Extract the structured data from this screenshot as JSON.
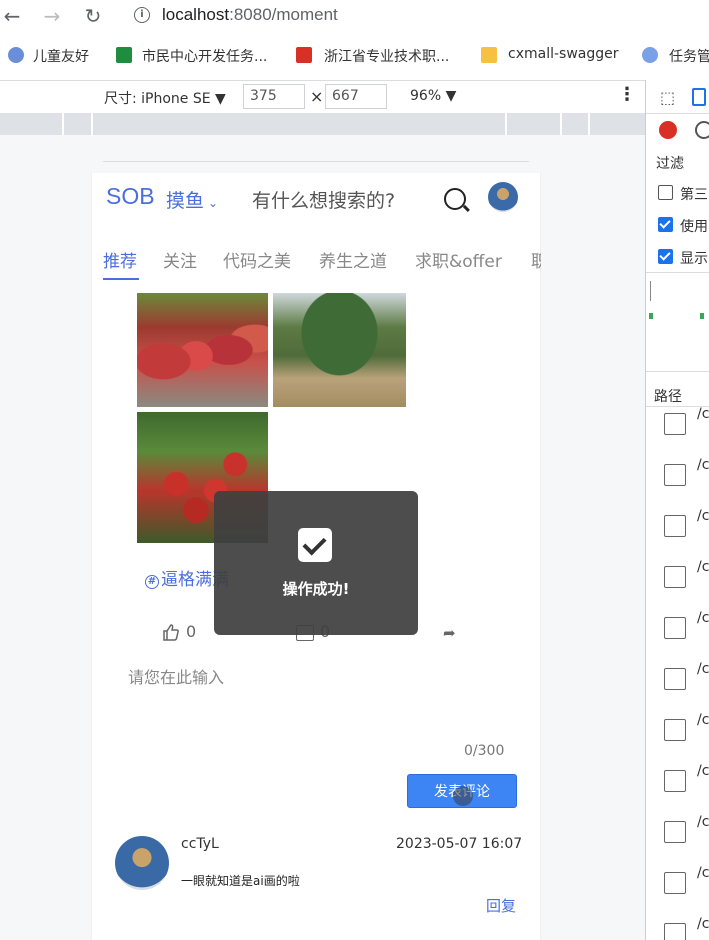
{
  "browser": {
    "url_host": "localhost",
    "url_rest": ":8080/moment"
  },
  "bookmarks": [
    {
      "label": "儿童友好",
      "color": "#6a8fd8"
    },
    {
      "label": "市民中心开发任务...",
      "color": "#1e8e3e"
    },
    {
      "label": "浙江省专业技术职...",
      "color": "#d93025"
    },
    {
      "label": "cxmall-swagger",
      "color": "#f6c142"
    },
    {
      "label": "任务管",
      "color": "#4a6fdc"
    }
  ],
  "device_toolbar": {
    "dimensions_label": "尺寸: iPhone SE ▼",
    "width": "375",
    "times": "×",
    "height": "667",
    "zoom": "96% ▼"
  },
  "app": {
    "logo": "SOB",
    "section": "摸鱼",
    "search_placeholder": "有什么想搜索的?",
    "tabs": [
      "推荐",
      "关注",
      "代码之美",
      "养生之道",
      "求职&offer",
      "职"
    ],
    "post": {
      "tag": "逼格满满",
      "likes": "0",
      "comments": "0"
    },
    "comment_input_placeholder": "请您在此输入",
    "char_counter": "0/300",
    "submit_label": "发表评论",
    "comment": {
      "user": "ccTyL",
      "time": "2023-05-07 16:07",
      "text": "一眼就知道是ai画的啦",
      "reply_label": "回复"
    },
    "toast": "操作成功!"
  },
  "devtools": {
    "filter_label": "过滤",
    "checkbox_1": "第三",
    "checkbox_2": "使用",
    "checkbox_3": "显示",
    "path_header": "路径",
    "request_prefix": "/c"
  },
  "colors": {
    "accent": "#4a6fdc",
    "button": "#3d84f5",
    "checkbox_on": "#1a73e8",
    "record": "#d93025"
  }
}
